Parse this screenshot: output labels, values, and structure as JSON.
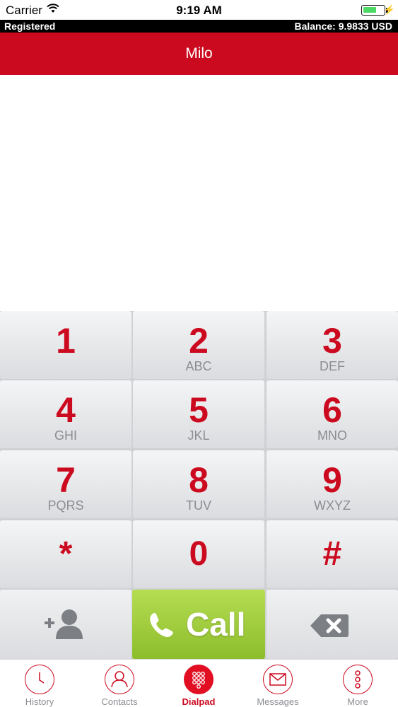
{
  "status_bar": {
    "carrier": "Carrier",
    "time": "9:19 AM",
    "battery_icon": "battery-charging-icon",
    "wifi_icon": "wifi-icon"
  },
  "registration": {
    "status": "Registered",
    "balance": "Balance: 9.9833 USD"
  },
  "title": "Milo",
  "display": {
    "number": ""
  },
  "keypad": {
    "keys": [
      {
        "digit": "1",
        "letters": ""
      },
      {
        "digit": "2",
        "letters": "ABC"
      },
      {
        "digit": "3",
        "letters": "DEF"
      },
      {
        "digit": "4",
        "letters": "GHI"
      },
      {
        "digit": "5",
        "letters": "JKL"
      },
      {
        "digit": "6",
        "letters": "MNO"
      },
      {
        "digit": "7",
        "letters": "PQRS"
      },
      {
        "digit": "8",
        "letters": "TUV"
      },
      {
        "digit": "9",
        "letters": "WXYZ"
      },
      {
        "digit": "*",
        "letters": ""
      },
      {
        "digit": "0",
        "letters": ""
      },
      {
        "digit": "#",
        "letters": ""
      }
    ],
    "call_label": "Call",
    "add_contact_icon": "add-contact-icon",
    "backspace_icon": "backspace-icon"
  },
  "tabs": [
    {
      "label": "History",
      "icon": "clock-icon",
      "active": false
    },
    {
      "label": "Contacts",
      "icon": "person-icon",
      "active": false
    },
    {
      "label": "Dialpad",
      "icon": "dialpad-icon",
      "active": true
    },
    {
      "label": "Messages",
      "icon": "envelope-icon",
      "active": false
    },
    {
      "label": "More",
      "icon": "more-dots-icon",
      "active": false
    }
  ],
  "colors": {
    "brand_red": "#cc0a1f",
    "call_green": "#9fcc3b",
    "tab_gray": "#8a8d92"
  }
}
